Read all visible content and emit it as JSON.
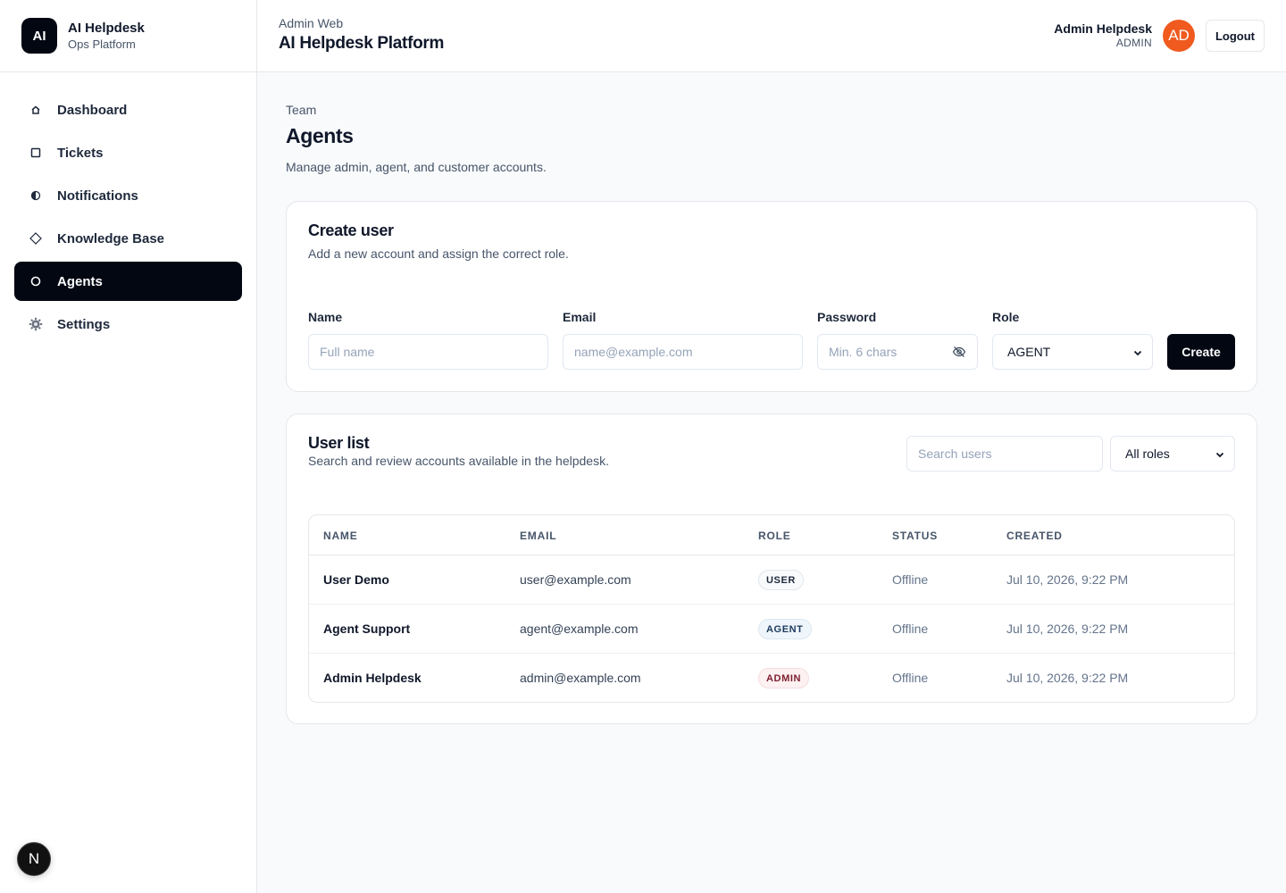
{
  "brand": {
    "logo": "AI",
    "name": "AI Helpdesk",
    "subtitle": "Ops Platform"
  },
  "sidebar": {
    "items": [
      {
        "label": "Dashboard",
        "icon": "home-icon"
      },
      {
        "label": "Tickets",
        "icon": "square-icon"
      },
      {
        "label": "Notifications",
        "icon": "half-circle-icon"
      },
      {
        "label": "Knowledge Base",
        "icon": "diamond-icon"
      },
      {
        "label": "Agents",
        "icon": "circle-icon",
        "active": true
      },
      {
        "label": "Settings",
        "icon": "gear-icon"
      }
    ],
    "dev_badge": "N"
  },
  "header": {
    "subtitle": "Admin Web",
    "title": "AI Helpdesk Platform",
    "user_name": "Admin Helpdesk",
    "user_role": "ADMIN",
    "avatar_initials": "AD",
    "logout_label": "Logout"
  },
  "page": {
    "breadcrumb": "Team",
    "title": "Agents",
    "description": "Manage admin, agent, and customer accounts."
  },
  "create_user": {
    "title": "Create user",
    "description": "Add a new account and assign the correct role.",
    "name_label": "Name",
    "name_placeholder": "Full name",
    "email_label": "Email",
    "email_placeholder": "name@example.com",
    "password_label": "Password",
    "password_placeholder": "Min. 6 chars",
    "role_label": "Role",
    "role_value": "AGENT",
    "create_label": "Create"
  },
  "user_list": {
    "title": "User list",
    "description": "Search and review accounts available in the helpdesk.",
    "search_placeholder": "Search users",
    "role_filter": "All roles",
    "columns": [
      "NAME",
      "EMAIL",
      "ROLE",
      "STATUS",
      "CREATED"
    ],
    "rows": [
      {
        "name": "User Demo",
        "email": "user@example.com",
        "role": "USER",
        "status": "Offline",
        "created": "Jul 10, 2026, 9:22 PM"
      },
      {
        "name": "Agent Support",
        "email": "agent@example.com",
        "role": "AGENT",
        "status": "Offline",
        "created": "Jul 10, 2026, 9:22 PM"
      },
      {
        "name": "Admin Helpdesk",
        "email": "admin@example.com",
        "role": "ADMIN",
        "status": "Offline",
        "created": "Jul 10, 2026, 9:22 PM"
      }
    ]
  },
  "colors": {
    "primary": "#030712",
    "avatar": "#f05a1f",
    "text_muted": "#475569",
    "border": "#e5e7eb"
  }
}
